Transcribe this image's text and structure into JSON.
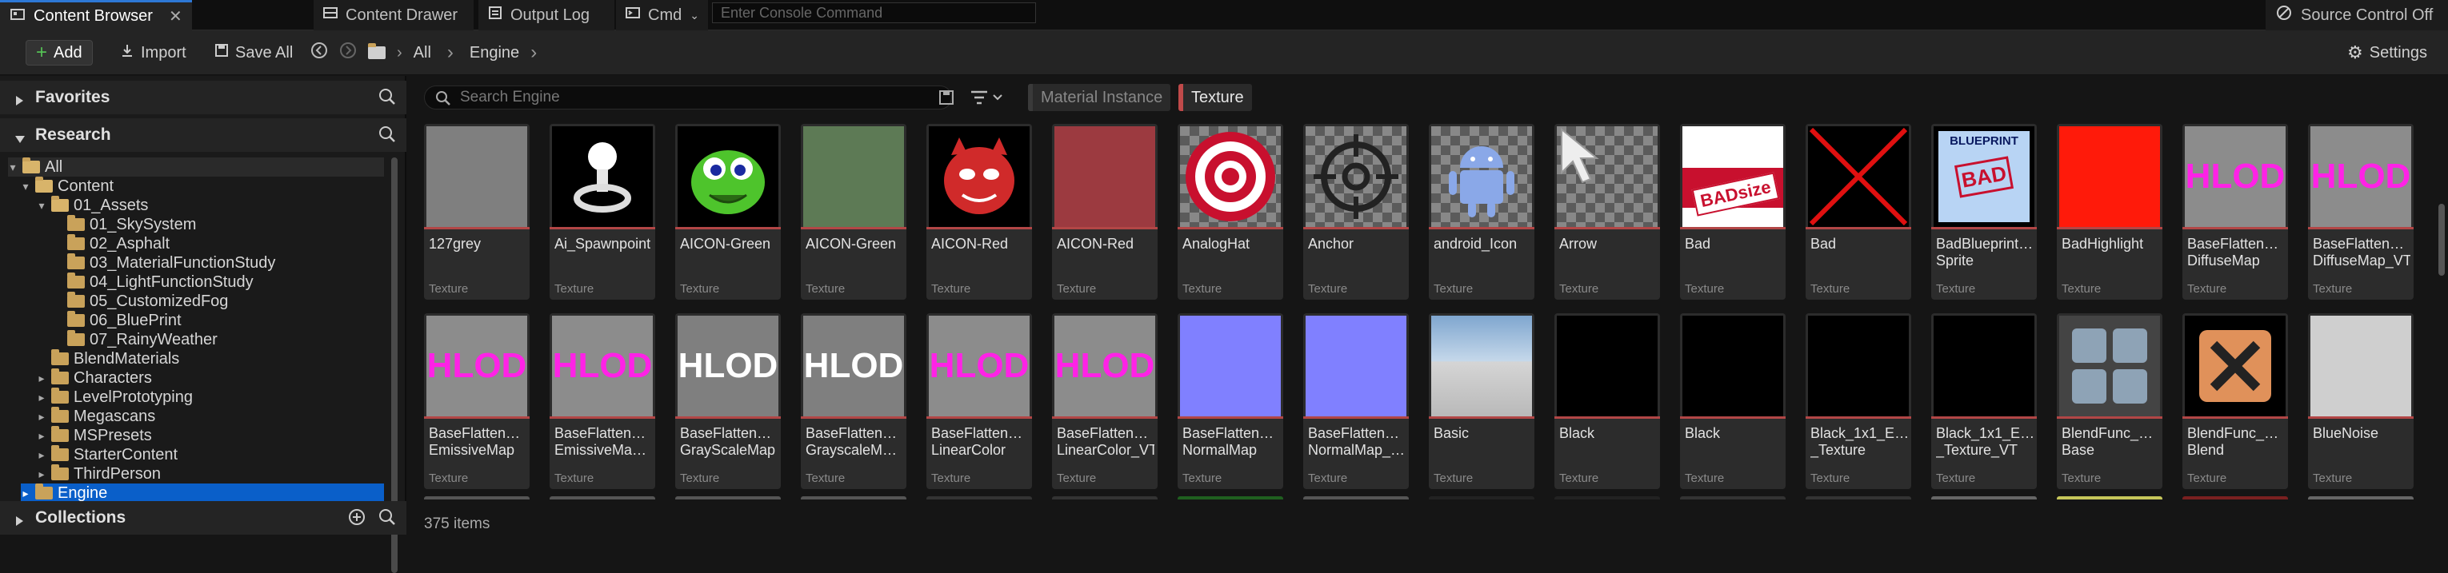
{
  "tabs": {
    "content_browser": "Content Browser",
    "content_drawer": "Content Drawer",
    "output_log": "Output Log",
    "cmd": "Cmd",
    "console_placeholder": "Enter Console Command",
    "source_control": "Source Control Off"
  },
  "toolbar": {
    "add": "Add",
    "import": "Import",
    "save_all": "Save All",
    "breadcrumb": [
      "All",
      "Engine"
    ],
    "settings": "Settings"
  },
  "left": {
    "favorites": "Favorites",
    "research": "Research",
    "collections": "Collections",
    "tree": [
      {
        "label": "All",
        "depth": 0,
        "expanded": true
      },
      {
        "label": "Content",
        "depth": 1,
        "expanded": true
      },
      {
        "label": "01_Assets",
        "depth": 2,
        "expanded": true
      },
      {
        "label": "01_SkySystem",
        "depth": 3
      },
      {
        "label": "02_Asphalt",
        "depth": 3
      },
      {
        "label": "03_MaterialFunctionStudy",
        "depth": 3
      },
      {
        "label": "04_LightFunctionStudy",
        "depth": 3
      },
      {
        "label": "05_CustomizedFog",
        "depth": 3
      },
      {
        "label": "06_BluePrint",
        "depth": 3
      },
      {
        "label": "07_RainyWeather",
        "depth": 3
      },
      {
        "label": "BlendMaterials",
        "depth": 2
      },
      {
        "label": "Characters",
        "depth": 2,
        "collapsed": true
      },
      {
        "label": "LevelPrototyping",
        "depth": 2,
        "collapsed": true
      },
      {
        "label": "Megascans",
        "depth": 2,
        "collapsed": true
      },
      {
        "label": "MSPresets",
        "depth": 2,
        "collapsed": true
      },
      {
        "label": "StarterContent",
        "depth": 2,
        "collapsed": true
      },
      {
        "label": "ThirdPerson",
        "depth": 2,
        "collapsed": true
      },
      {
        "label": "Engine",
        "depth": 1,
        "collapsed": true,
        "selected": true
      }
    ]
  },
  "main": {
    "search_placeholder": "Search Engine",
    "filters": [
      {
        "label": "Material Instance",
        "color": "#3a3a3a",
        "active": false
      },
      {
        "label": "Texture",
        "color": "#c04a4a",
        "active": true
      }
    ],
    "status": "375 items",
    "assets_row1": [
      {
        "name": "127grey",
        "type": "Texture",
        "thumb": "grey"
      },
      {
        "name": "Ai_Spawnpoint",
        "type": "Texture",
        "thumb": "spawn"
      },
      {
        "name": "AICON-Green",
        "type": "Texture",
        "thumb": "green-face"
      },
      {
        "name": "AICON-Green",
        "type": "Texture",
        "thumb": "green-flat"
      },
      {
        "name": "AICON-Red",
        "type": "Texture",
        "thumb": "red-face"
      },
      {
        "name": "AICON-Red",
        "type": "Texture",
        "thumb": "red-flat"
      },
      {
        "name": "AnalogHat",
        "type": "Texture",
        "thumb": "target"
      },
      {
        "name": "Anchor",
        "type": "Texture",
        "thumb": "anchor"
      },
      {
        "name": "android_Icon",
        "type": "Texture",
        "thumb": "android"
      },
      {
        "name": "Arrow",
        "type": "Texture",
        "thumb": "arrow"
      },
      {
        "name": "Bad",
        "type": "Texture",
        "thumb": "badsize"
      },
      {
        "name": "Bad",
        "type": "Texture",
        "thumb": "bad-x"
      },
      {
        "name": "BadBlueprint…\nSprite",
        "type": "Texture",
        "thumb": "blueprint"
      },
      {
        "name": "BadHighlight",
        "type": "Texture",
        "thumb": "red-solid"
      },
      {
        "name": "BaseFlatten…\nDiffuseMap",
        "type": "Texture",
        "thumb": "hlod-magenta"
      },
      {
        "name": "BaseFlatten…\nDiffuseMap_VT",
        "type": "Texture",
        "thumb": "hlod-magenta"
      }
    ],
    "assets_row2": [
      {
        "name": "BaseFlatten…\nEmissiveMap",
        "type": "Texture",
        "thumb": "hlod-magenta"
      },
      {
        "name": "BaseFlatten…\nEmissiveMa…",
        "type": "Texture",
        "thumb": "hlod-magenta"
      },
      {
        "name": "BaseFlatten…\nGrayScaleMap",
        "type": "Texture",
        "thumb": "hlod-white"
      },
      {
        "name": "BaseFlatten…\nGrayscaleM…",
        "type": "Texture",
        "thumb": "hlod-white"
      },
      {
        "name": "BaseFlatten…\nLinearColor",
        "type": "Texture",
        "thumb": "hlod-magenta"
      },
      {
        "name": "BaseFlatten…\nLinearColor_VT",
        "type": "Texture",
        "thumb": "hlod-magenta"
      },
      {
        "name": "BaseFlatten…\nNormalMap",
        "type": "Texture",
        "thumb": "normal"
      },
      {
        "name": "BaseFlatten…\nNormalMap_…",
        "type": "Texture",
        "thumb": "normal"
      },
      {
        "name": "Basic",
        "type": "Texture",
        "thumb": "basic"
      },
      {
        "name": "Black",
        "type": "Texture",
        "thumb": "black"
      },
      {
        "name": "Black",
        "type": "Texture",
        "thumb": "black"
      },
      {
        "name": "Black_1x1_E…\n_Texture",
        "type": "Texture",
        "thumb": "black"
      },
      {
        "name": "Black_1x1_E…\n_Texture_VT",
        "type": "Texture",
        "thumb": "black"
      },
      {
        "name": "BlendFunc_…\nBase",
        "type": "Texture",
        "thumb": "blend-base"
      },
      {
        "name": "BlendFunc_…\nBlend",
        "type": "Texture",
        "thumb": "blend-x"
      },
      {
        "name": "BlueNoise",
        "type": "Texture",
        "thumb": "noise"
      }
    ],
    "thumb_text": {
      "hlod": "HLOD",
      "bad_size": "BADsize",
      "blueprint_top": "BLUEPRINT",
      "blueprint_bad": "BAD"
    }
  }
}
